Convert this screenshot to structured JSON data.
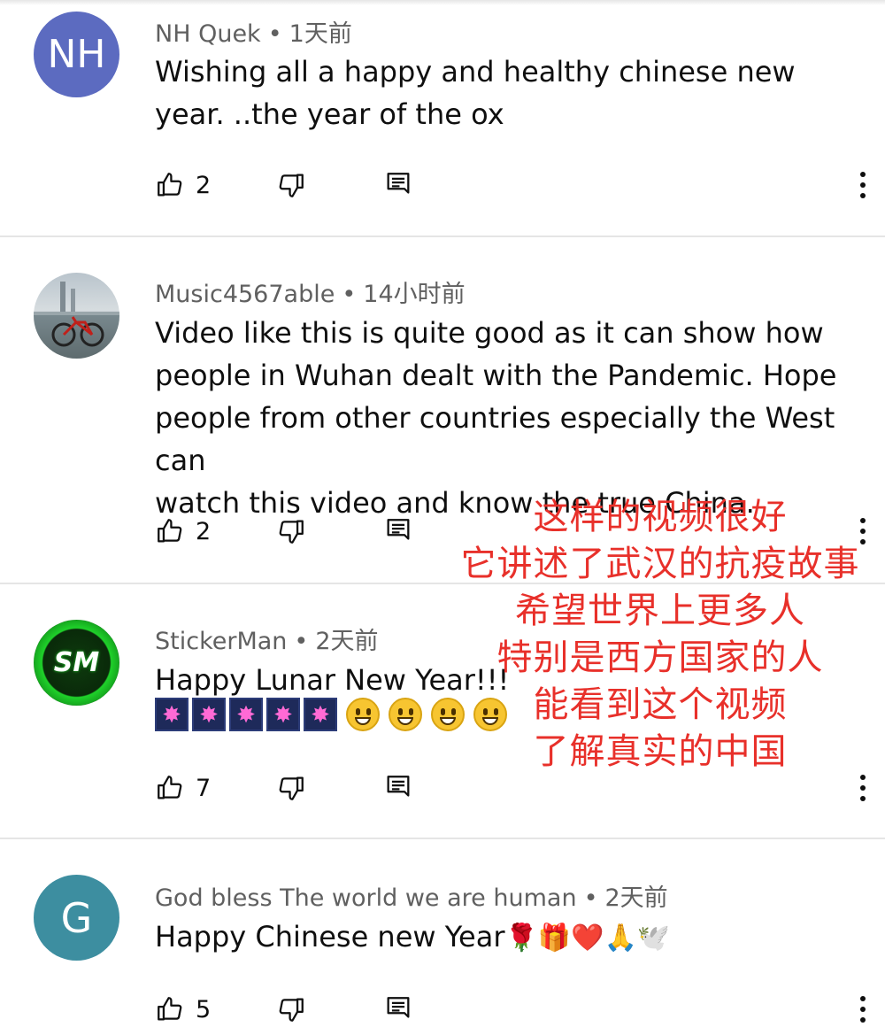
{
  "comments": [
    {
      "avatar_text": "NH",
      "avatar_color": "#5c6bc0",
      "author": "NH Quek",
      "time": "1天前",
      "text_lines": [
        "Wishing all a happy and healthy chinese new",
        "year. ..the year of the ox"
      ],
      "likes": "2"
    },
    {
      "avatar_text": "",
      "author": "Music4567able",
      "time": "14小时前",
      "text_lines": [
        "Video like this is quite good as it can show how",
        "people in Wuhan dealt with the Pandemic.  Hope",
        "people from other countries especially the West can",
        "watch this video and know the true China."
      ],
      "likes": "2"
    },
    {
      "avatar_text": "SM",
      "avatar_color": "#1fd12a",
      "author": "StickerMan",
      "time": "2天前",
      "text_lines": [
        "Happy Lunar New Year!!!"
      ],
      "likes": "7"
    },
    {
      "avatar_text": "G",
      "avatar_color": "#3d8ea0",
      "author": "God bless The world we are human",
      "time": "2天前",
      "text": "Happy Chinese new Year",
      "text_emoji": "🌹🎁❤️🙏🕊️",
      "likes": "5"
    }
  ],
  "separator": "•",
  "overlay_lines": [
    "这样的视频很好",
    "它讲述了武汉的抗疫故事",
    "希望世界上更多人",
    "特别是西方国家的人",
    "能看到这个视频",
    "了解真实的中国"
  ],
  "icons": [
    "thumb-up-icon",
    "thumb-down-icon",
    "reply-icon",
    "more-vert-icon"
  ],
  "accent_overlay_color": "#e8302a"
}
